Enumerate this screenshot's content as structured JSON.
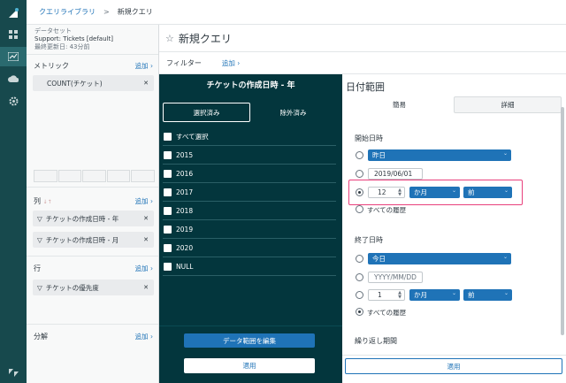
{
  "breadcrumb": {
    "library": "クエリライブラリ",
    "sep": ">",
    "current": "新規クエリ"
  },
  "dataset": {
    "label": "データセット",
    "name": "Support: Tickets [default]",
    "updated": "最終更新日: 43分前"
  },
  "metrics": {
    "title": "メトリック",
    "add": "追加 ›",
    "items": [
      "COUNT(チケット)"
    ]
  },
  "columns": {
    "title": "列",
    "add": "追加 ›",
    "items": [
      "チケットの作成日時 - 年",
      "チケットの作成日時 - 月"
    ]
  },
  "rows": {
    "title": "行",
    "add": "追加 ›",
    "items": [
      "チケットの優先度"
    ]
  },
  "explode": {
    "title": "分解",
    "add": "追加 ›"
  },
  "query": {
    "star": "☆",
    "title": "新規クエリ"
  },
  "filter": {
    "label": "フィルター",
    "add": "追加 ›"
  },
  "filter_panel": {
    "title": "チケットの作成日時 - 年",
    "tab_selected": "選択済み",
    "tab_excluded": "除外済み",
    "select_all": "すべて選択",
    "values": [
      "2015",
      "2016",
      "2017",
      "2018",
      "2019",
      "2020",
      "NULL"
    ],
    "edit_range": "データ範囲を編集",
    "apply": "適用"
  },
  "date_range": {
    "title": "日付範囲",
    "tab_simple": "簡易",
    "tab_detail": "詳細",
    "start": {
      "label": "開始日時",
      "yesterday": "昨日",
      "date_value": "2019/06/01",
      "relative_number": "12",
      "relative_unit": "か月",
      "relative_dir": "前",
      "all_history": "すべての履歴"
    },
    "end": {
      "label": "終了日時",
      "today": "今日",
      "date_placeholder": "YYYY/MM/DD",
      "relative_number": "1",
      "relative_unit": "か月",
      "relative_dir": "前",
      "all_history": "すべての履歴"
    },
    "repeat": "繰り返し期間",
    "apply": "適用"
  },
  "colors": {
    "rail": "#17494d",
    "dark_panel": "#03363d",
    "accent": "#1f73b7",
    "highlight": "#e8407c"
  }
}
